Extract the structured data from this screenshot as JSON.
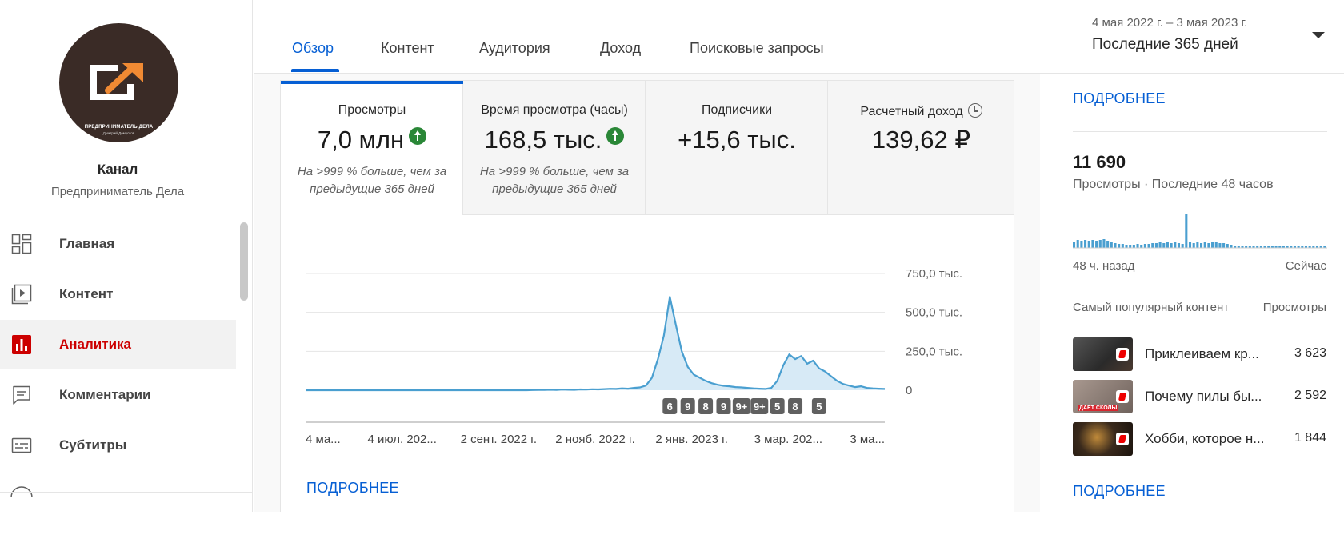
{
  "sidebar": {
    "channel_label": "Канал",
    "channel_name": "Предприниматель Дела",
    "logo_text": "ПРЕДПРИНИМАТЕЛЬ ДЕЛА",
    "logo_subtext": "Дмитрий Домусков",
    "items": [
      {
        "label": "Главная",
        "icon": "dashboard-icon"
      },
      {
        "label": "Контент",
        "icon": "video-content-icon"
      },
      {
        "label": "Аналитика",
        "icon": "analytics-icon"
      },
      {
        "label": "Комментарии",
        "icon": "comments-icon"
      },
      {
        "label": "Субтитры",
        "icon": "subtitles-icon"
      }
    ],
    "active_index": 2
  },
  "header": {
    "tabs": [
      "Обзор",
      "Контент",
      "Аудитория",
      "Доход",
      "Поисковые запросы"
    ],
    "active_tab": 0,
    "date_range": "4 мая 2022 г. – 3 мая 2023 г.",
    "date_preset": "Последние 365 дней"
  },
  "metrics": [
    {
      "title": "Просмотры",
      "value": "7,0 млн",
      "trend": "up",
      "note": "На >999 % больше, чем за предыдущие 365 дней"
    },
    {
      "title": "Время просмотра (часы)",
      "value": "168,5 тыс.",
      "trend": "up",
      "note": "На >999 % больше, чем за предыдущие 365 дней"
    },
    {
      "title": "Подписчики",
      "value": "+15,6 тыс.",
      "trend": "",
      "note": ""
    },
    {
      "title": "Расчетный доход",
      "value": "139,62 ₽",
      "trend": "",
      "note": ""
    }
  ],
  "more_label": "ПОДРОБНЕЕ",
  "chart_data": {
    "type": "line",
    "series": [
      {
        "values": [
          0,
          0,
          0,
          0,
          0,
          0,
          0,
          0,
          0,
          0,
          0,
          0,
          0,
          0,
          0,
          0,
          0,
          0,
          0,
          0,
          0,
          0,
          0,
          0,
          0,
          0,
          0,
          0,
          0,
          0,
          0,
          0,
          0,
          0,
          0,
          0,
          0,
          0,
          1000,
          2000,
          1500,
          3000,
          2000,
          4000,
          3000,
          2500,
          5000,
          4000,
          6000,
          5000,
          7000,
          9000,
          8000,
          12000,
          10000,
          15000,
          18000,
          30000,
          80000,
          200000,
          350000,
          600000,
          420000,
          250000,
          150000,
          100000,
          80000,
          60000,
          45000,
          35000,
          28000,
          25000,
          20000,
          18000,
          15000,
          12000,
          10000,
          8000,
          15000,
          60000,
          160000,
          230000,
          200000,
          220000,
          170000,
          190000,
          140000,
          120000,
          90000,
          60000,
          40000,
          30000,
          20000,
          25000,
          15000,
          12000,
          10000,
          8000
        ]
      }
    ],
    "x_tick_labels": [
      "4 ма...",
      "4 июл. 202...",
      "2 сент. 2022 г.",
      "2 нояб. 2022 г.",
      "2 янв. 2023 г.",
      "3 мар. 202...",
      "3 ма..."
    ],
    "y_tick_labels": [
      "750,0 тыс.",
      "500,0 тыс.",
      "250,0 тыс.",
      "0"
    ],
    "y_ticks": [
      750000,
      500000,
      250000,
      0
    ],
    "ylim": [
      0,
      750000
    ],
    "grid": true,
    "markers": [
      {
        "label": "6",
        "index": 61
      },
      {
        "label": "9",
        "index": 64
      },
      {
        "label": "8",
        "index": 67
      },
      {
        "label": "9",
        "index": 70
      },
      {
        "label": "9+",
        "index": 73
      },
      {
        "label": "9+",
        "index": 76
      },
      {
        "label": "5",
        "index": 79
      },
      {
        "label": "8",
        "index": 82
      },
      {
        "label": "5",
        "index": 86
      }
    ]
  },
  "realtime": {
    "value": "11 690",
    "caption": "Просмотры · Последние 48 часов",
    "left_label": "48 ч. назад",
    "right_label": "Сейчас",
    "bars": [
      8,
      10,
      9,
      10,
      9,
      10,
      9,
      10,
      11,
      9,
      8,
      6,
      5,
      5,
      4,
      4,
      4,
      5,
      4,
      5,
      5,
      6,
      6,
      7,
      6,
      7,
      6,
      7,
      6,
      5,
      42,
      8,
      6,
      7,
      6,
      7,
      6,
      7,
      7,
      6,
      6,
      5,
      4,
      3,
      3,
      3,
      3,
      2,
      3,
      2,
      3,
      3,
      3,
      2,
      3,
      2,
      3,
      2,
      2,
      3,
      3,
      2,
      3,
      2,
      3,
      2,
      3,
      2
    ]
  },
  "top_content": {
    "header_left": "Самый популярный контент",
    "header_right": "Просмотры",
    "items": [
      {
        "title": "Приклеиваем кр...",
        "views": "3 623",
        "thumb_color": "#3d3d3d",
        "thumb_caption": ""
      },
      {
        "title": "Почему пилы бы...",
        "views": "2 592",
        "thumb_color": "#8a7a72",
        "thumb_caption": "ДАЕТ СКОЛЫ"
      },
      {
        "title": "Хобби, которое н...",
        "views": "1 844",
        "thumb_color": "#3a2a1c",
        "thumb_caption": ""
      }
    ]
  },
  "colors": {
    "accent": "#065fd4",
    "active_nav": "#cc0000",
    "chart_line": "#4a9fd0",
    "chart_fill": "#d7eaf6",
    "trend_up": "#2a8737"
  }
}
